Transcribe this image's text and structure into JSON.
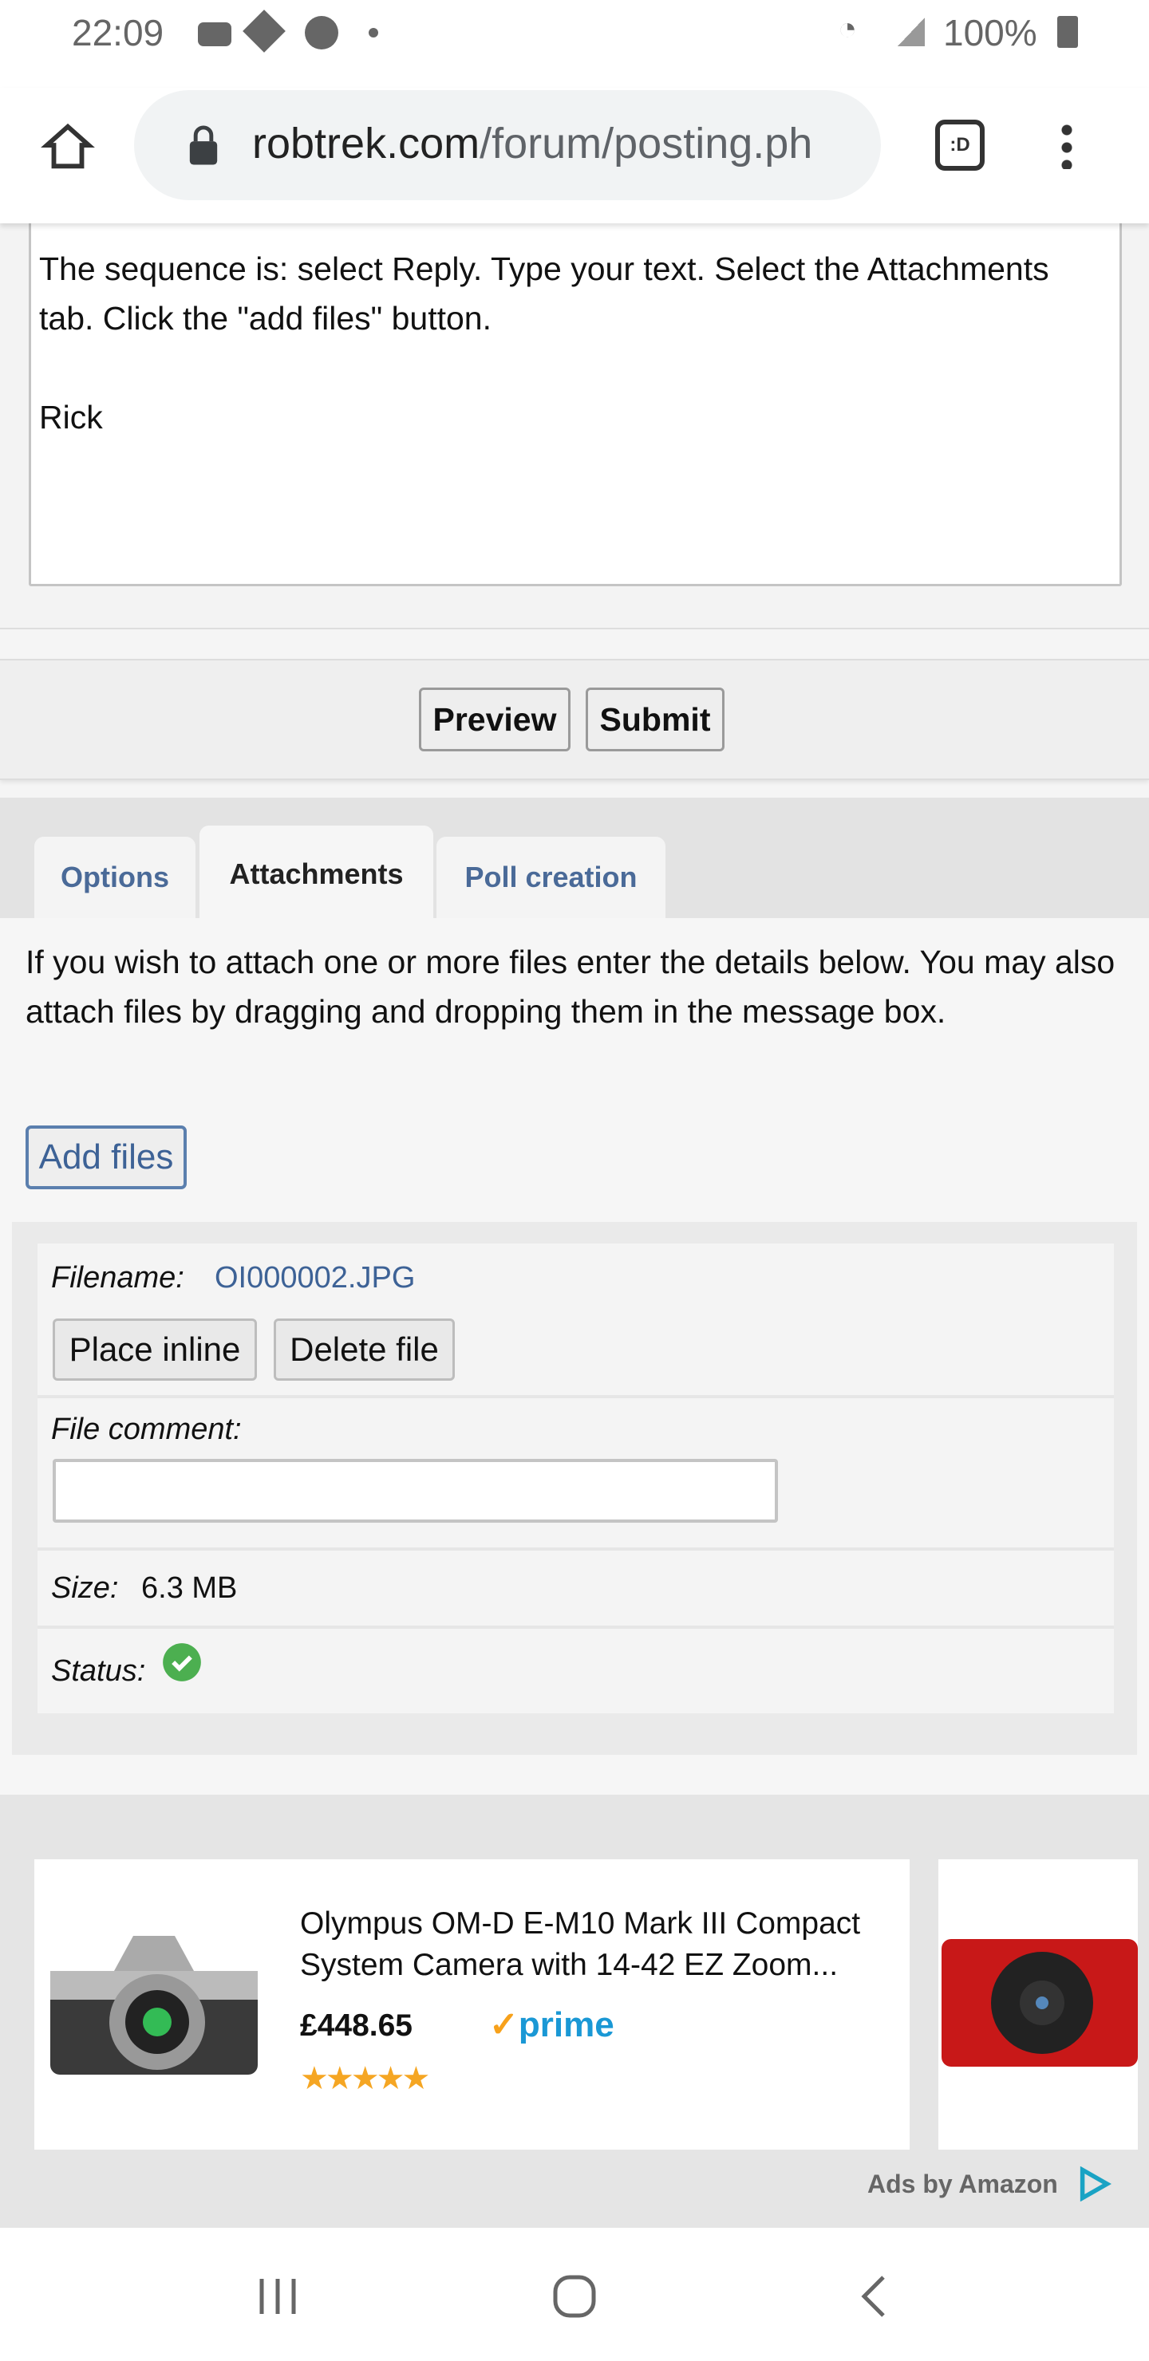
{
  "status_bar": {
    "time": "22:09",
    "battery": "100%",
    "icons": [
      "youtube-icon",
      "app-icon",
      "chrome-icon",
      "dot-icon",
      "wifi-icon",
      "signal-icon",
      "battery-icon"
    ]
  },
  "browser": {
    "url_domain": "robtrek.com",
    "url_path": "/forum/posting.ph",
    "icons": [
      "home-icon",
      "lock-icon",
      "tab-switcher-icon",
      "menu-icon"
    ],
    "tab_label": ":D"
  },
  "editor": {
    "lines": [
      "The sequence is: select Reply. Type your text. Select the Attachments tab. Click the \"add files\" button.",
      "Rick"
    ]
  },
  "actions": {
    "preview": "Preview",
    "submit": "Submit"
  },
  "tabs": [
    {
      "label": "Options"
    },
    {
      "label": "Attachments",
      "active": true
    },
    {
      "label": "Poll creation"
    }
  ],
  "attachments": {
    "intro": "If you wish to attach one or more files enter the details below. You may also attach files by dragging and dropping them in the message box.",
    "add_files": "Add files",
    "filename_label": "Filename:",
    "filename": "OI000002.JPG",
    "place_inline": "Place inline",
    "delete_file": "Delete file",
    "comment_label": "File comment:",
    "comment_value": "",
    "size_label": "Size:",
    "size": "6.3 MB",
    "status_label": "Status:",
    "status_icon": "check-circle-icon",
    "status_color": "#4caf50"
  },
  "ad": {
    "title": "Olympus OM-D E-M10 Mark III Compact System Camera with 14-42 EZ Zoom...",
    "price": "£448.65",
    "prime": "prime",
    "rating": 5,
    "footer": "Ads by Amazon"
  },
  "colors": {
    "link": "#3d6296",
    "tab_text": "#4a6a98",
    "prime": "#1a98d5",
    "prime_check": "#f7a11b",
    "stars": "#f5a623"
  }
}
